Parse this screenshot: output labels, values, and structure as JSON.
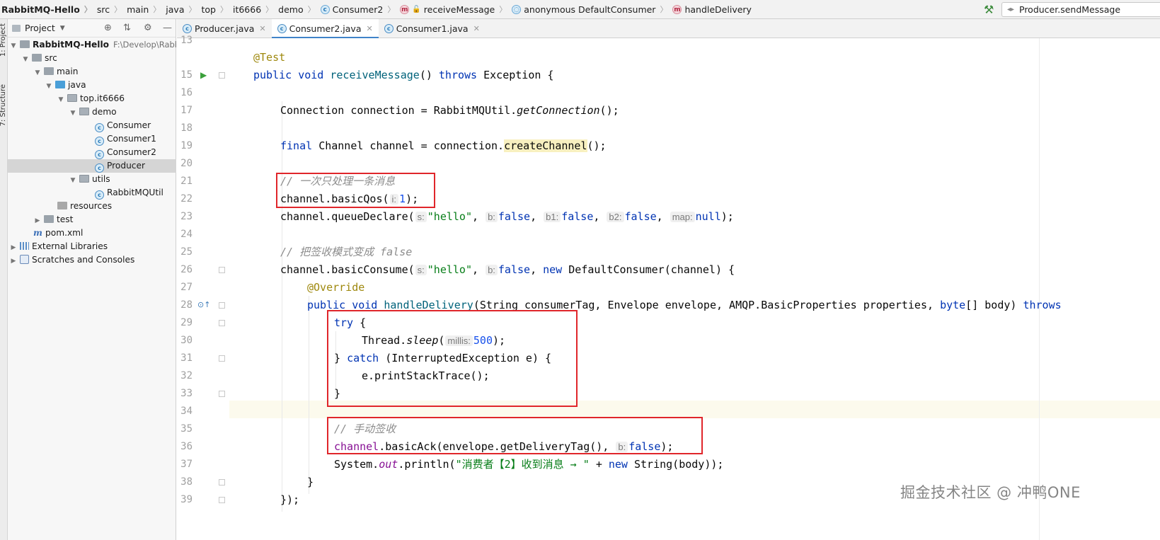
{
  "breadcrumb": {
    "items": [
      {
        "label": "RabbitMQ-Hello",
        "icon": "none"
      },
      {
        "label": "src",
        "icon": "none"
      },
      {
        "label": "main",
        "icon": "none"
      },
      {
        "label": "java",
        "icon": "none"
      },
      {
        "label": "top",
        "icon": "none"
      },
      {
        "label": "it6666",
        "icon": "none"
      },
      {
        "label": "demo",
        "icon": "none"
      },
      {
        "label": "Consumer2",
        "icon": "class-icon"
      },
      {
        "label": "receiveMessage",
        "icon": "method-icon"
      },
      {
        "label": "anonymous DefaultConsumer",
        "icon": "anonymous-class-icon"
      },
      {
        "label": "handleDelivery",
        "icon": "method-icon"
      }
    ]
  },
  "toolbar": {
    "run_config": "Producer.sendMessage"
  },
  "side_strip": {
    "project_tab": "1: Project",
    "structure_tab": "7: Structure"
  },
  "project_panel": {
    "title": "Project",
    "tree": [
      {
        "label": "RabbitMQ-Hello",
        "path": "F:\\Develop\\RabbitMQ",
        "depth": 0,
        "icon": "module-folder",
        "expanded": true,
        "bold": true
      },
      {
        "label": "src",
        "depth": 1,
        "icon": "folder",
        "expanded": true
      },
      {
        "label": "main",
        "depth": 2,
        "icon": "folder",
        "expanded": true
      },
      {
        "label": "java",
        "depth": 3,
        "icon": "source-folder",
        "expanded": true
      },
      {
        "label": "top.it6666",
        "depth": 4,
        "icon": "package",
        "expanded": true
      },
      {
        "label": "demo",
        "depth": 5,
        "icon": "package",
        "expanded": true
      },
      {
        "label": "Consumer",
        "depth": 6,
        "icon": "java-class"
      },
      {
        "label": "Consumer1",
        "depth": 6,
        "icon": "java-class"
      },
      {
        "label": "Consumer2",
        "depth": 6,
        "icon": "java-class"
      },
      {
        "label": "Producer",
        "depth": 6,
        "icon": "java-class",
        "selected": true
      },
      {
        "label": "utils",
        "depth": 5,
        "icon": "package",
        "expanded": true
      },
      {
        "label": "RabbitMQUtil",
        "depth": 6,
        "icon": "java-class"
      },
      {
        "label": "resources",
        "depth": 3,
        "icon": "resources-folder"
      },
      {
        "label": "test",
        "depth": 2,
        "icon": "folder",
        "expanded": false
      },
      {
        "label": "pom.xml",
        "depth": 1,
        "icon": "maven-file"
      },
      {
        "label": "External Libraries",
        "depth": 0,
        "icon": "libraries",
        "expanded": false
      },
      {
        "label": "Scratches and Consoles",
        "depth": 0,
        "icon": "scratches",
        "expanded": false
      }
    ]
  },
  "tabs": [
    {
      "label": "Producer.java",
      "active": false
    },
    {
      "label": "Consumer2.java",
      "active": true
    },
    {
      "label": "Consumer1.java",
      "active": false
    }
  ],
  "editor": {
    "line_numbers": [
      "13",
      "15",
      "16",
      "17",
      "18",
      "19",
      "20",
      "21",
      "22",
      "23",
      "24",
      "25",
      "26",
      "27",
      "28",
      "29",
      "30",
      "31",
      "32",
      "33",
      "34",
      "35",
      "36",
      "37",
      "38",
      "39"
    ],
    "code": {
      "l14_ann": "@Test",
      "l15_kw1": "public",
      "l15_kw2": "void",
      "l15_fn": "receiveMessage",
      "l15_p": "()",
      "l15_kw3": "throws",
      "l15_t": "Exception {",
      "l17_a": "Connection connection = RabbitMQUtil.",
      "l17_m": "getConnection",
      "l17_b": "();",
      "l19_kw": "final",
      "l19_a": "Channel channel = connection.",
      "l19_m": "createChannel",
      "l19_b": "();",
      "l21_cm": "// 一次只处理一条消息",
      "l22_a": "channel.basicQos(",
      "l22_h": "i:",
      "l22_n": "1",
      "l22_b": ");",
      "l23_a": "channel.queueDeclare(",
      "l23_h1": "s:",
      "l23_s": "\"hello\"",
      "l23_c1": ",",
      "l23_h2": "b:",
      "l23_k1": "false",
      "l23_c2": ",",
      "l23_h3": "b1:",
      "l23_k2": "false",
      "l23_c3": ",",
      "l23_h4": "b2:",
      "l23_k3": "false",
      "l23_c4": ",",
      "l23_h5": "map:",
      "l23_k4": "null",
      "l23_b": ");",
      "l25_cm": "// 把签收模式变成 false",
      "l26_a": "channel.basicConsume(",
      "l26_h1": "s:",
      "l26_s": "\"hello\"",
      "l26_c1": ",",
      "l26_h2": "b:",
      "l26_k1": "false",
      "l26_c2": ",",
      "l26_k2": "new",
      "l26_b": "DefaultConsumer(channel) {",
      "l27_ann": "@Override",
      "l28_kw1": "public",
      "l28_kw2": "void",
      "l28_fn": "handleDelivery",
      "l28_a": "(String consumerTag, Envelope envelope, AMQP.BasicProperties properties,",
      "l28_kw3": "byte",
      "l28_b": "[] body)",
      "l28_kw4": "throws",
      "l29_kw": "try",
      "l29_b": "{",
      "l30_a": "Thread.",
      "l30_m": "sleep",
      "l30_p": "(",
      "l30_h": "millis:",
      "l30_n": "500",
      "l30_b": ");",
      "l31_a": "}",
      "l31_kw": "catch",
      "l31_b": "(InterruptedException e) {",
      "l32_a": "e.printStackTrace();",
      "l33_a": "}",
      "l35_cm": "// 手动签收",
      "l36_f": "channel",
      "l36_a": ".basicAck(envelope.getDeliveryTag(),",
      "l36_h": "b:",
      "l36_k": "false",
      "l36_b": ");",
      "l37_a": "System.",
      "l37_f": "out",
      "l37_b": ".println(",
      "l37_s": "\"消费者【2】收到消息 → \"",
      "l37_c": "+",
      "l37_kw": "new",
      "l37_d": "String(body));",
      "l38_a": "}",
      "l39_a": "});"
    }
  },
  "watermark": "掘金技术社区 @ 冲鸭ONE"
}
